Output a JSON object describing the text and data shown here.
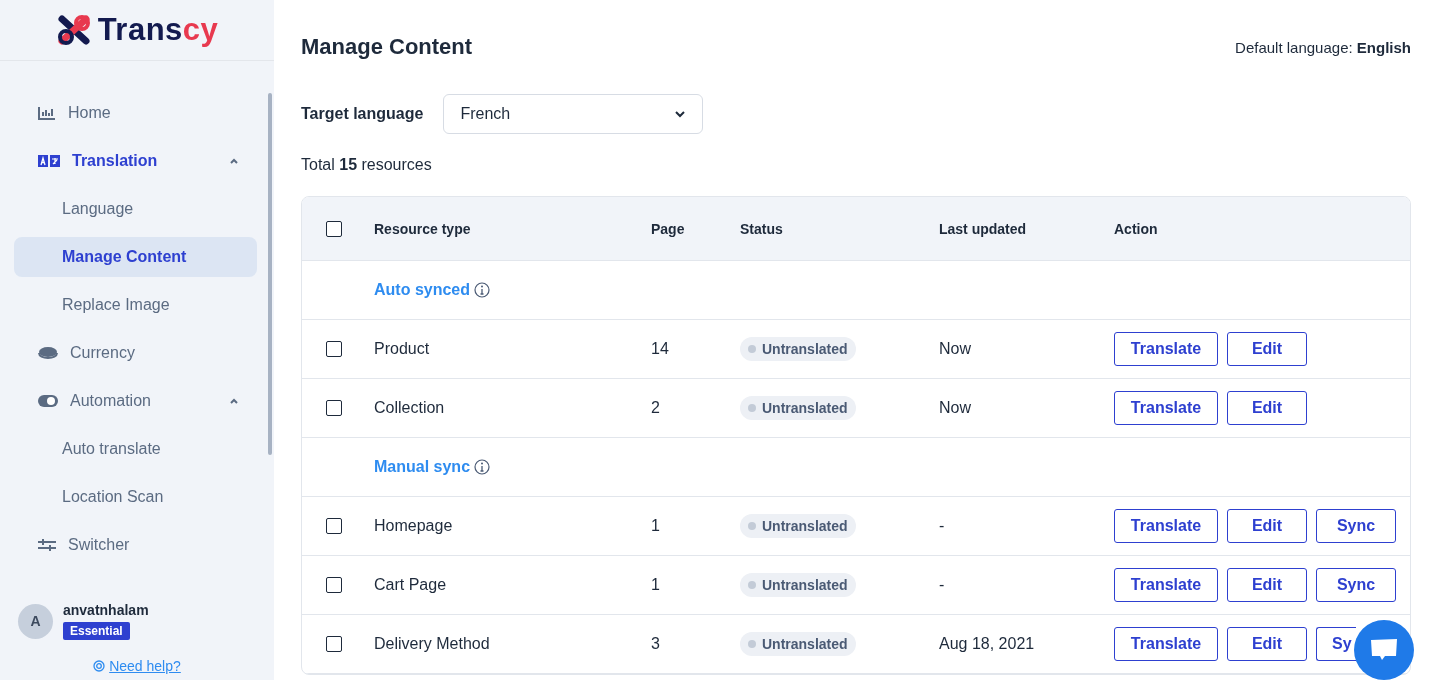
{
  "logo": {
    "main": "Trans",
    "accent": "cy"
  },
  "sidebar": {
    "items": [
      {
        "label": "Home",
        "selected": false
      },
      {
        "label": "Translation",
        "selected": true,
        "expanded": true,
        "children": [
          {
            "label": "Language",
            "selected": false
          },
          {
            "label": "Manage Content",
            "selected": true
          },
          {
            "label": "Replace Image",
            "selected": false
          }
        ]
      },
      {
        "label": "Currency",
        "selected": false
      },
      {
        "label": "Automation",
        "selected": false,
        "expanded": true,
        "children": [
          {
            "label": "Auto translate",
            "selected": false
          },
          {
            "label": "Location Scan",
            "selected": false
          }
        ]
      },
      {
        "label": "Switcher",
        "selected": false
      }
    ]
  },
  "user": {
    "avatar": "A",
    "name": "anvatnhalam",
    "plan": "Essential"
  },
  "help_link": "Need help?",
  "page_title": "Manage Content",
  "default_language": {
    "label": "Default language:",
    "value": "English"
  },
  "target_language": {
    "label": "Target language",
    "value": "French"
  },
  "total": {
    "prefix": "Total",
    "count": "15",
    "suffix": "resources"
  },
  "table": {
    "select_all": false,
    "columns": [
      "Resource type",
      "Page",
      "Status",
      "Last updated",
      "Action"
    ],
    "rows": [
      {
        "kind": "group",
        "label": "Auto synced"
      },
      {
        "kind": "item",
        "checked": false,
        "type": "Product",
        "page": "14",
        "status": "Untranslated",
        "updated": "Now",
        "actions": [
          "Translate",
          "Edit"
        ]
      },
      {
        "kind": "item",
        "checked": false,
        "type": "Collection",
        "page": "2",
        "status": "Untranslated",
        "updated": "Now",
        "actions": [
          "Translate",
          "Edit"
        ]
      },
      {
        "kind": "group",
        "label": "Manual sync"
      },
      {
        "kind": "item",
        "checked": false,
        "type": "Homepage",
        "page": "1",
        "status": "Untranslated",
        "updated": "-",
        "actions": [
          "Translate",
          "Edit",
          "Sync"
        ]
      },
      {
        "kind": "item",
        "checked": false,
        "type": "Cart Page",
        "page": "1",
        "status": "Untranslated",
        "updated": "-",
        "actions": [
          "Translate",
          "Edit",
          "Sync"
        ]
      },
      {
        "kind": "item",
        "checked": false,
        "type": "Delivery Method",
        "page": "3",
        "status": "Untranslated",
        "updated": "Aug 18, 2021",
        "actions": [
          "Translate",
          "Edit",
          "Sy"
        ]
      }
    ]
  }
}
